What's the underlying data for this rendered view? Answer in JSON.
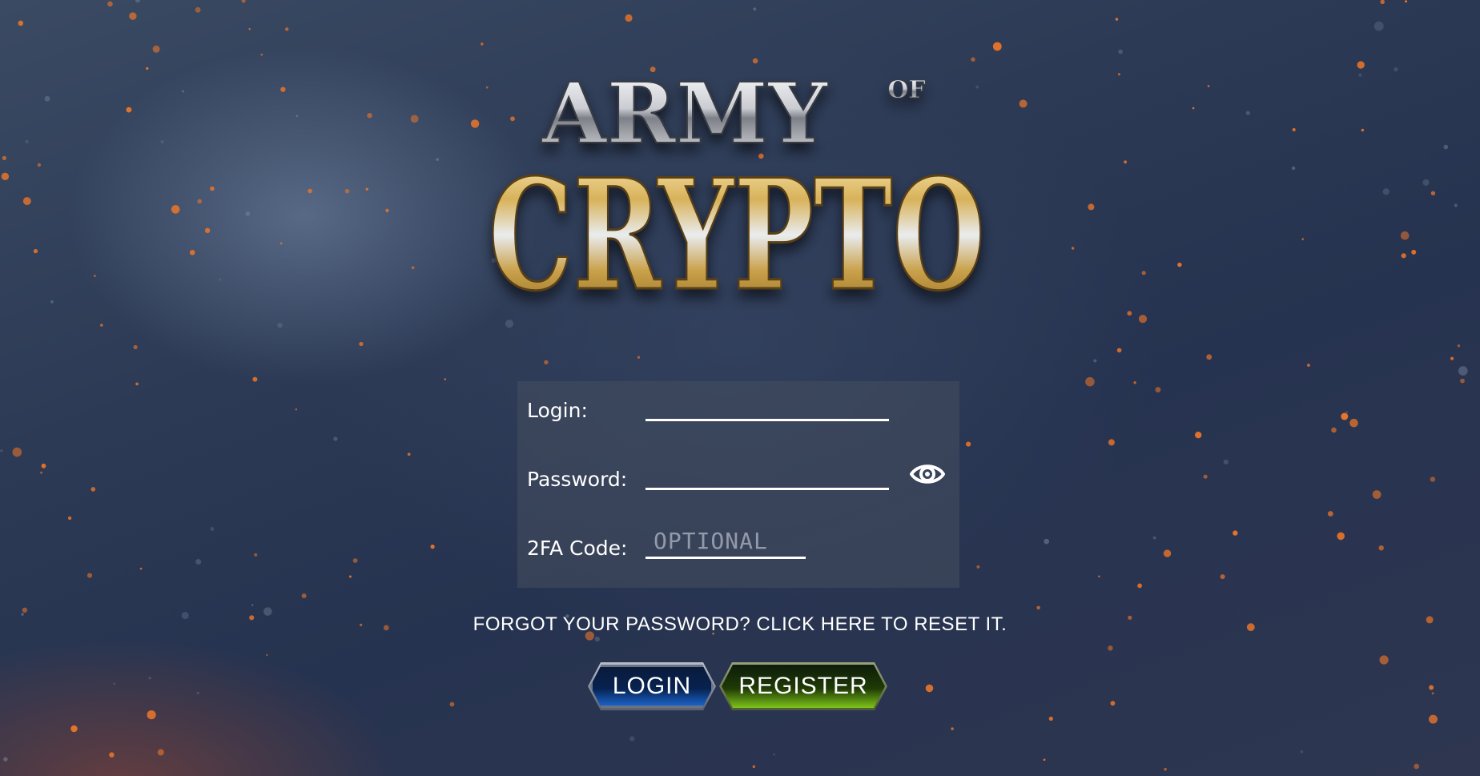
{
  "logo": {
    "line1": "ARMY",
    "small": "OF",
    "line2": "CRYPTO"
  },
  "form": {
    "login_label": "Login:",
    "login_value": "",
    "password_label": "Password:",
    "password_value": "",
    "twofa_label": "2FA Code:",
    "twofa_placeholder": "OPTIONAL",
    "show_password_icon": "eye-icon"
  },
  "forgot_text": "FORGOT YOUR PASSWORD? CLICK HERE TO RESET IT.",
  "buttons": {
    "login": "LOGIN",
    "register": "REGISTER"
  },
  "colors": {
    "background": "#2c3a55",
    "spark": "#e8742a",
    "gold": "#d8b25a",
    "login_button": "#1d6bd6",
    "register_button": "#7dc41a"
  }
}
